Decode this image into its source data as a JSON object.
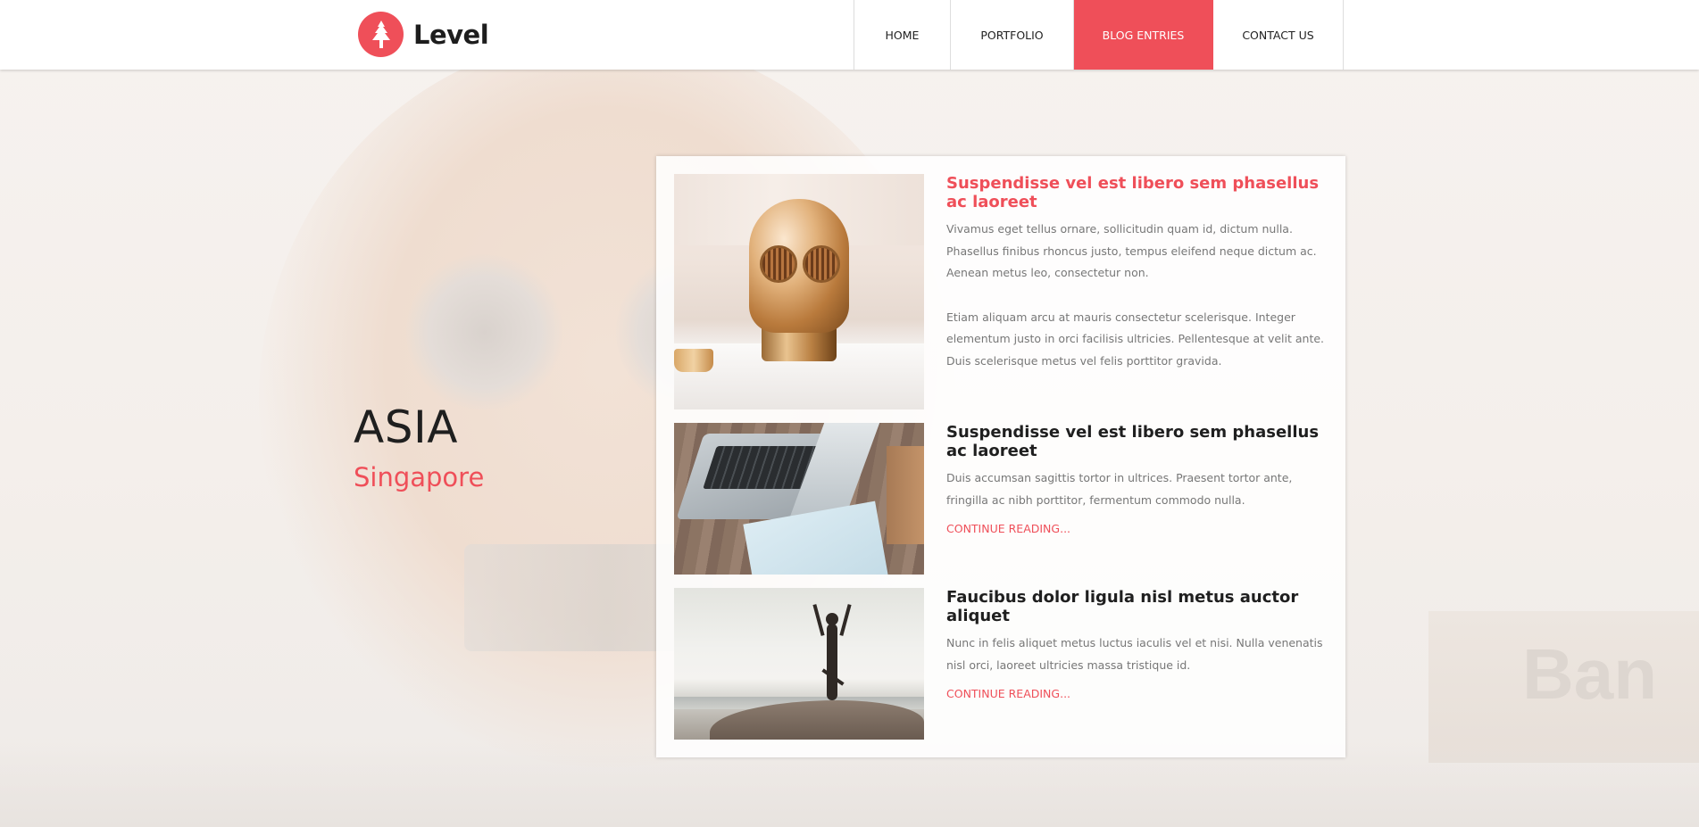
{
  "brand": {
    "name": "Level",
    "icon": "tree-icon",
    "accent_color": "#ef4f59"
  },
  "nav": {
    "items": [
      {
        "label": "HOME",
        "active": false
      },
      {
        "label": "PORTFOLIO",
        "active": false
      },
      {
        "label": "BLOG ENTRIES",
        "active": true
      },
      {
        "label": "CONTACT US",
        "active": false
      }
    ]
  },
  "location": {
    "region": "ASIA",
    "city": "Singapore"
  },
  "posts": [
    {
      "title": "Suspendisse vel est libero sem phasellus ac laoreet",
      "paragraphs": [
        "Vivamus eget tellus ornare, sollicitudin quam id, dictum nulla. Phasellus finibus rhoncus justo, tempus eleifend neque dictum ac. Aenean metus leo, consectetur non.",
        "Etiam aliquam arcu at mauris consectetur scelerisque. Integer elementum justo in orci facilisis ultricies. Pellentesque at velit ante. Duis scelerisque metus vel felis porttitor gravida."
      ],
      "image": "robot-head-image"
    },
    {
      "title": "Suspendisse vel est libero sem phasellus ac laoreet",
      "paragraphs": [
        "Duis accumsan sagittis tortor in ultrices. Praesent tortor ante, fringilla ac nibh porttitor, fermentum commodo nulla."
      ],
      "link": "CONTINUE READING...",
      "image": "laptop-image"
    },
    {
      "title": "Faucibus dolor ligula nisl metus auctor aliquet",
      "paragraphs": [
        "Nunc in felis aliquet metus luctus iaculis vel et nisi. Nulla venenatis nisl orci, laoreet ultricies massa tristique id."
      ],
      "link": "CONTINUE READING...",
      "image": "yoga-beach-image"
    }
  ],
  "background": {
    "box_text": "Ban"
  }
}
